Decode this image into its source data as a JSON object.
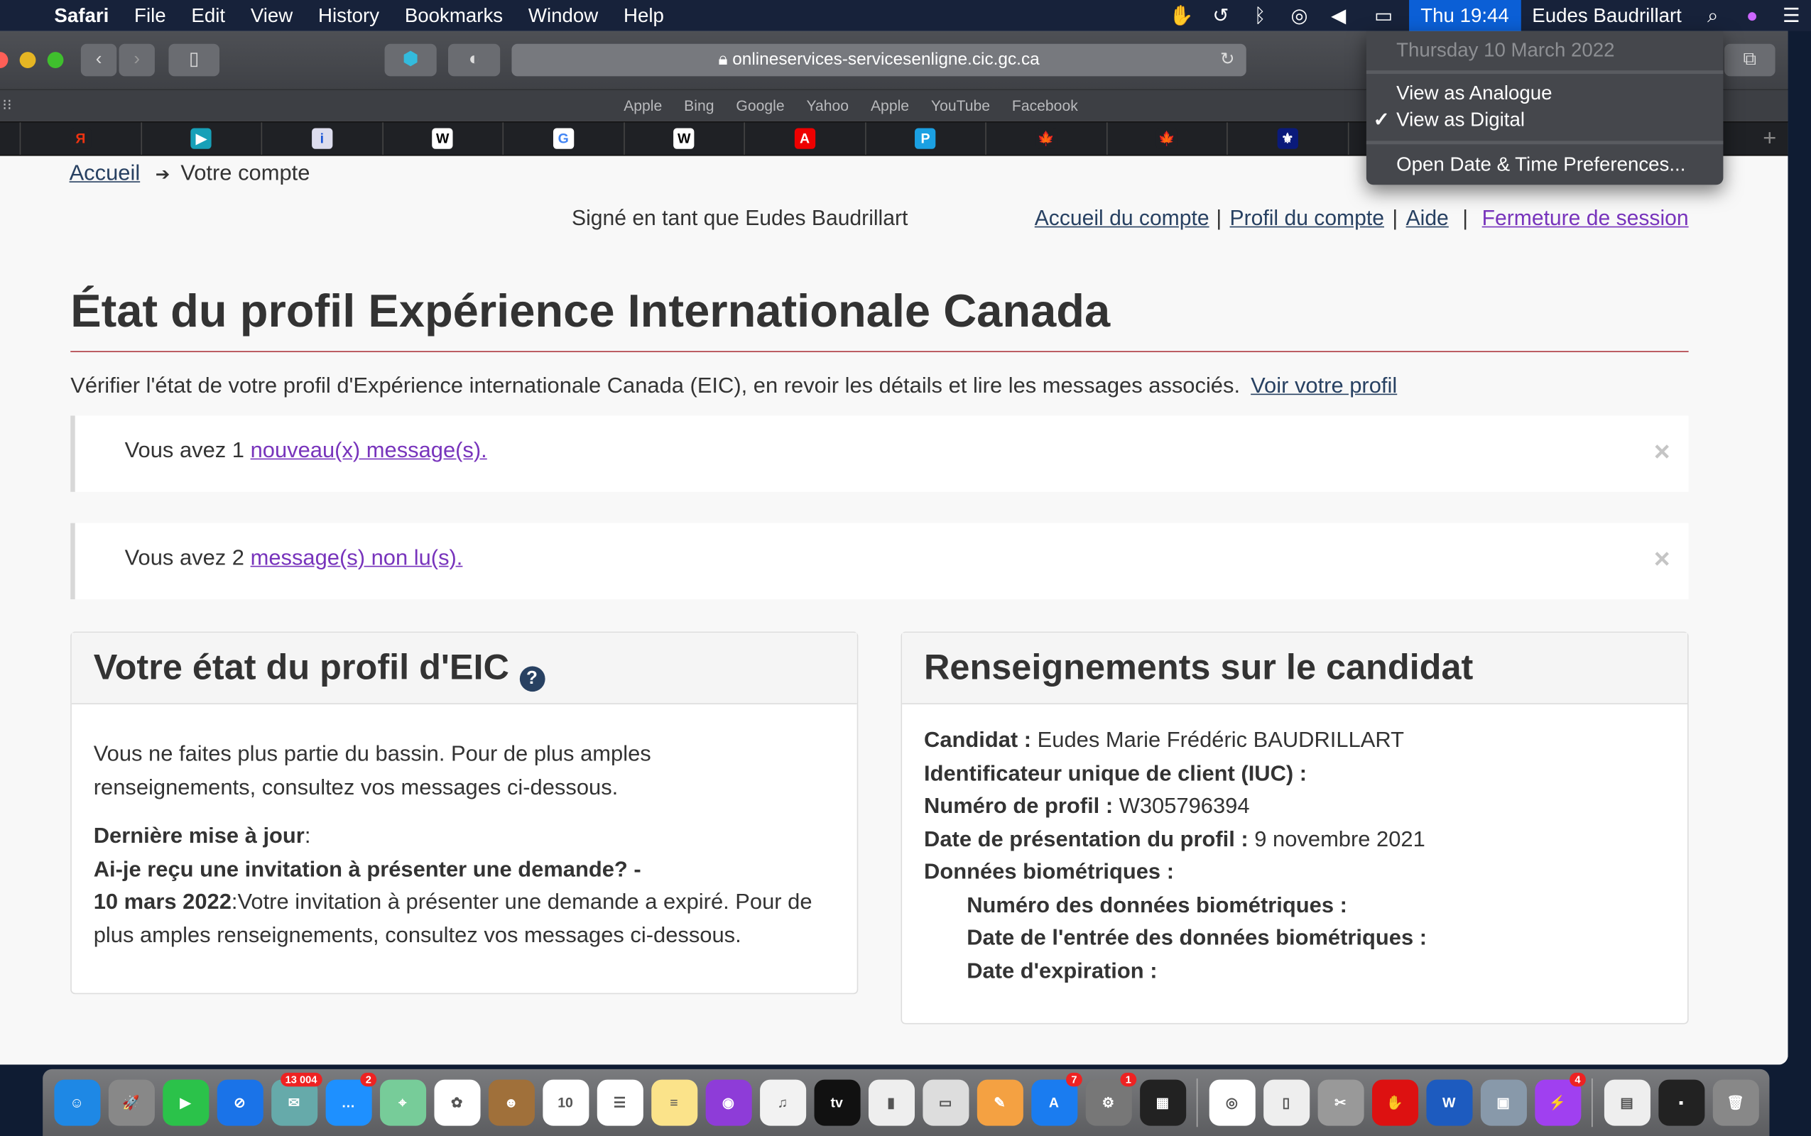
{
  "menubar": {
    "app": "Safari",
    "items": [
      "File",
      "Edit",
      "View",
      "History",
      "Bookmarks",
      "Window",
      "Help"
    ],
    "clock": "Thu 19:44",
    "user": "Eudes Baudrillart"
  },
  "clock_menu": {
    "date": "Thursday 10 March 2022",
    "analogue": "View as Analogue",
    "digital": "View as Digital",
    "digital_checked": true,
    "check": "✓",
    "prefs": "Open Date & Time Preferences..."
  },
  "browser": {
    "url": "onlineservices-servicesenligne.cic.gc.ca",
    "favorites": [
      "Apple",
      "Bing",
      "Google",
      "Yahoo",
      "Apple",
      "YouTube",
      "Facebook"
    ],
    "tabs": [
      {
        "glyph": "Я",
        "bg": "#1f2125",
        "fg": "#e31"
      },
      {
        "glyph": "▶",
        "bg": "#17a0b8",
        "fg": "#fff"
      },
      {
        "glyph": "i",
        "bg": "#dde",
        "fg": "#1a55d6"
      },
      {
        "glyph": "W",
        "bg": "#fff",
        "fg": "#000"
      },
      {
        "glyph": "G",
        "bg": "#fff",
        "fg": "#4285f4"
      },
      {
        "glyph": "W",
        "bg": "#fff",
        "fg": "#000"
      },
      {
        "glyph": "A",
        "bg": "#e00",
        "fg": "#fff"
      },
      {
        "glyph": "P",
        "bg": "#1ba0e2",
        "fg": "#fff"
      },
      {
        "glyph": "🍁",
        "bg": "#1f2125",
        "fg": "#c00"
      },
      {
        "glyph": "🍁",
        "bg": "#1f2125",
        "fg": "#c00"
      },
      {
        "glyph": "⚜",
        "bg": "#0a1a7a",
        "fg": "#fff"
      }
    ]
  },
  "page": {
    "breadcrumb": {
      "home": "Accueil",
      "arrow": "➔",
      "current": "Votre compte"
    },
    "signed_in": "Signé en tant que Eudes Baudrillart",
    "nav": {
      "account_home": "Accueil du compte",
      "account_profile": "Profil du compte",
      "help": "Aide",
      "logout": "Fermeture de session",
      "sep": "|"
    },
    "title": "État du profil Expérience Internationale Canada",
    "intro": "Vérifier l'état de votre profil d'Expérience internationale Canada (EIC), en revoir les détails et lire les messages associés.",
    "intro_link": "Voir votre profil",
    "alerts": [
      {
        "prefix": "Vous avez 1",
        "link": "nouveau(x) message(s)."
      },
      {
        "prefix": "Vous avez 2",
        "link": "message(s) non lu(s)."
      }
    ],
    "close": "×",
    "status_panel": {
      "title": "Votre état du profil d'EIC",
      "help": "?",
      "text": "Vous ne faites plus partie du bassin. Pour de plus amples renseignements, consultez vos messages ci-dessous.",
      "updated_label": "Dernière mise à jour",
      "question": "Ai-je reçu une invitation à présenter une demande? -",
      "date": "10 mars 2022",
      "date_text": ":Votre invitation à présenter une demande a expiré. Pour de plus amples renseignements, consultez vos messages ci-dessous."
    },
    "candidate_panel": {
      "title": "Renseignements sur le candidat",
      "rows": [
        {
          "label": "Candidat :",
          "value": "Eudes Marie Frédéric BAUDRILLART"
        },
        {
          "label": "Identificateur unique de client (IUC) :",
          "value": ""
        },
        {
          "label": "Numéro de profil :",
          "value": "W305796394"
        },
        {
          "label": "Date de présentation du profil :",
          "value": "9 novembre 2021"
        },
        {
          "label": "Données biométriques :",
          "value": ""
        }
      ],
      "sub": [
        "Numéro des données biométriques :",
        "Date de l'entrée des données biométriques :",
        "Date d'expiration :"
      ]
    }
  },
  "dock": [
    {
      "name": "finder",
      "bg": "#1e88e5",
      "g": "☺"
    },
    {
      "name": "launchpad",
      "bg": "#888",
      "g": "🚀"
    },
    {
      "name": "facetime",
      "bg": "#2bc24a",
      "g": "▶"
    },
    {
      "name": "safari",
      "bg": "#1a73e8",
      "g": "⊘"
    },
    {
      "name": "preview",
      "bg": "#6aa",
      "g": "✉",
      "badge": "13 004"
    },
    {
      "name": "messages",
      "bg": "#1e90ff",
      "g": "…",
      "badge": "2"
    },
    {
      "name": "maps",
      "bg": "#7c9",
      "g": "⌖"
    },
    {
      "name": "photos",
      "bg": "#fff",
      "g": "✿"
    },
    {
      "name": "contacts",
      "bg": "#a0703a",
      "g": "☻"
    },
    {
      "name": "calendar",
      "bg": "#fff",
      "g": "10"
    },
    {
      "name": "reminders",
      "bg": "#fff",
      "g": "☰"
    },
    {
      "name": "notes",
      "bg": "#fbe38a",
      "g": "≡"
    },
    {
      "name": "podcasts",
      "bg": "#8e3cd8",
      "g": "◉"
    },
    {
      "name": "music",
      "bg": "#f2f2f2",
      "g": "♫"
    },
    {
      "name": "tv",
      "bg": "#111",
      "g": "tv"
    },
    {
      "name": "numbers",
      "bg": "#eee",
      "g": "▮"
    },
    {
      "name": "keynote",
      "bg": "#ddd",
      "g": "▭"
    },
    {
      "name": "pages",
      "bg": "#f4a142",
      "g": "✎"
    },
    {
      "name": "app-store",
      "bg": "#1a7cf0",
      "g": "A",
      "badge": "7"
    },
    {
      "name": "system-preferences",
      "bg": "#777",
      "g": "⚙",
      "badge": "1"
    },
    {
      "name": "activity-monitor",
      "bg": "#222",
      "g": "▦"
    },
    {
      "name": "chrome",
      "bg": "#fff",
      "g": "◎"
    },
    {
      "name": "textedit",
      "bg": "#eee",
      "g": "▯"
    },
    {
      "name": "utilities",
      "bg": "#999",
      "g": "✂"
    },
    {
      "name": "adblock",
      "bg": "#d11",
      "g": "✋"
    },
    {
      "name": "word",
      "bg": "#1d5bbf",
      "g": "W"
    },
    {
      "name": "image-capture",
      "bg": "#89a",
      "g": "▣"
    },
    {
      "name": "messenger",
      "bg": "#a040f0",
      "g": "⚡",
      "badge": "4"
    },
    {
      "name": "document",
      "bg": "#eee",
      "g": "▤"
    },
    {
      "name": "screenshot",
      "bg": "#222",
      "g": "▪"
    },
    {
      "name": "trash",
      "bg": "#888",
      "g": "🗑"
    }
  ]
}
